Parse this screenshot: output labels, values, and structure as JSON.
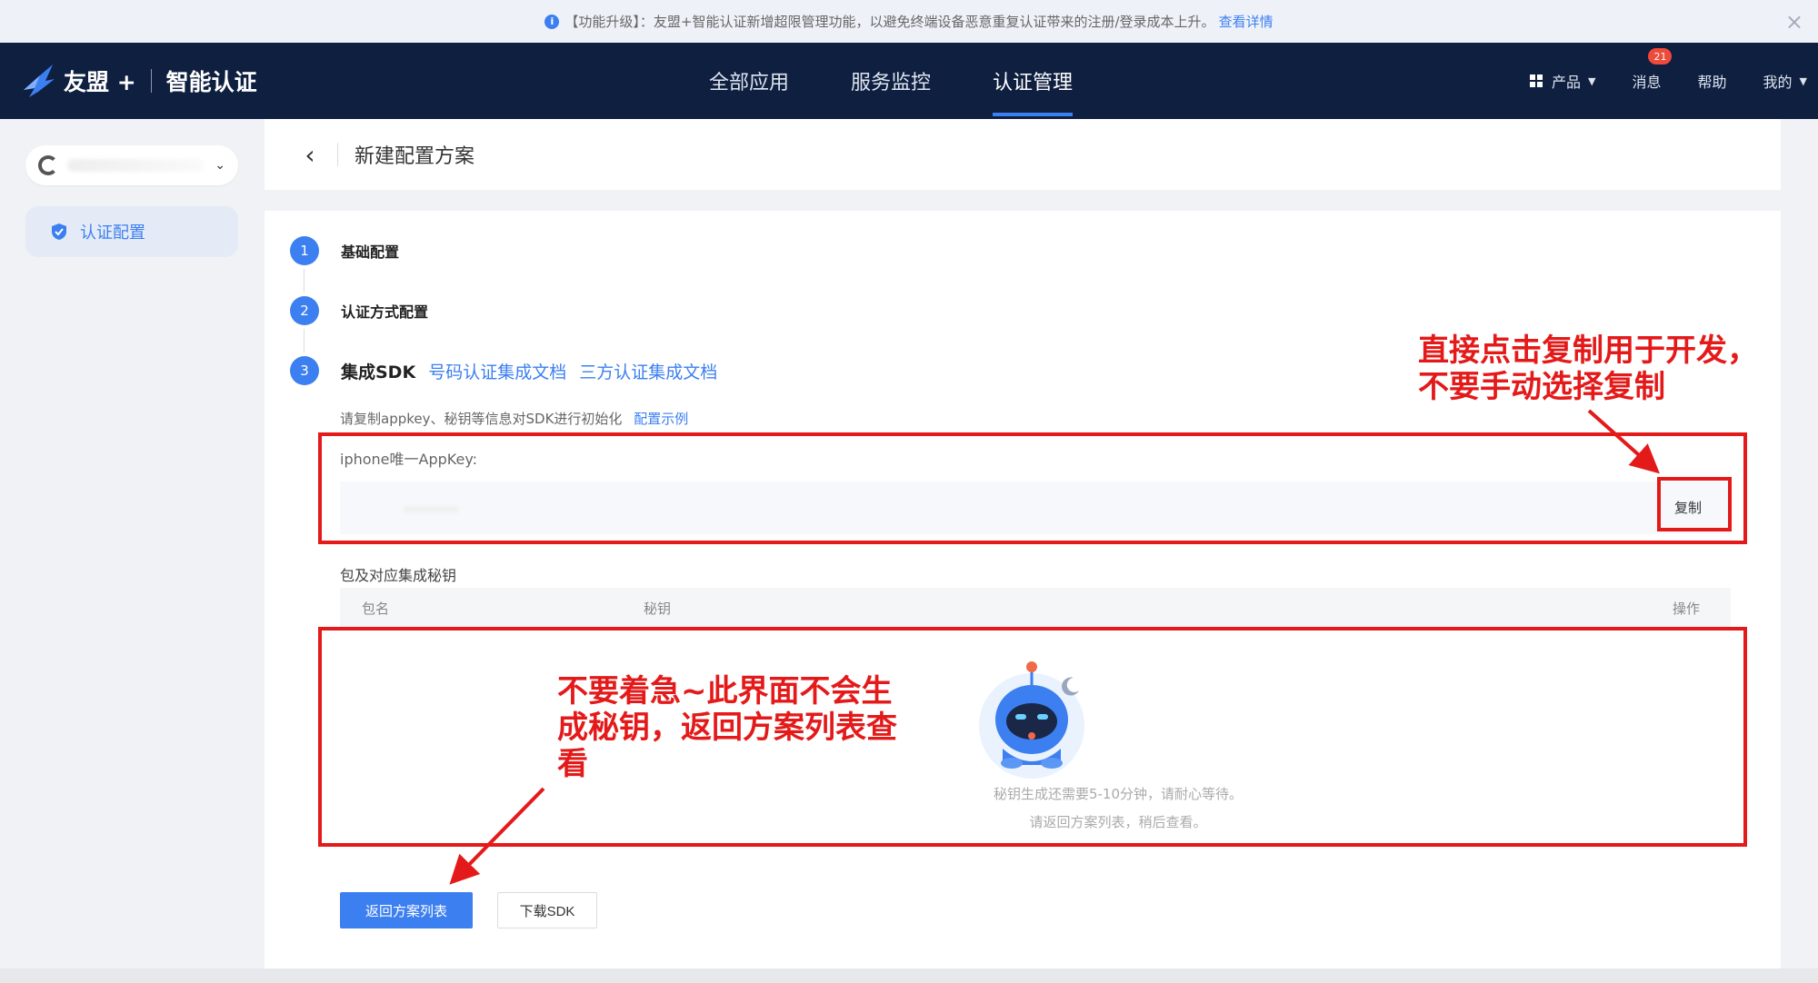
{
  "notice": {
    "text": "【功能升级】：友盟+智能认证新增超限管理功能，以避免终端设备恶意重复认证带来的注册/登录成本上升。",
    "link": "查看详情",
    "close": "×"
  },
  "topnav": {
    "brand": "友盟 +",
    "product": "智能认证",
    "items": [
      {
        "label": "全部应用"
      },
      {
        "label": "服务监控"
      },
      {
        "label": "认证管理"
      }
    ],
    "right": {
      "products": "产品",
      "messages": "消息",
      "messages_badge": "21",
      "help": "帮助",
      "mine": "我的"
    }
  },
  "sidebar": {
    "item": "认证配置"
  },
  "header": {
    "title": "新建配置方案"
  },
  "steps": [
    {
      "num": "1",
      "label": "基础配置"
    },
    {
      "num": "2",
      "label": "认证方式配置"
    },
    {
      "num": "3",
      "label": "集成SDK",
      "links": [
        "号码认证集成文档",
        "三方认证集成文档"
      ]
    }
  ],
  "sdk": {
    "hint": "请复制appkey、秘钥等信息对SDK进行初始化",
    "hint_link": "配置示例",
    "appkey_label": "iphone唯一AppKey:",
    "copy": "复制",
    "secret_label": "包及对应集成秘钥",
    "columns": [
      "包名",
      "秘钥",
      "操作"
    ],
    "empty_line1": "秘钥生成还需要5-10分钟，请耐心等待。",
    "empty_line2": "请返回方案列表，稍后查看。"
  },
  "buttons": {
    "back_list": "返回方案列表",
    "download": "下载SDK"
  },
  "annotations": {
    "copy_note": [
      "直接点击复制用于开发，",
      "不要手动选择复制"
    ],
    "wait_note": [
      "不要着急~此界面不会生",
      "成秘钥，返回方案列表查",
      "看"
    ]
  },
  "colors": {
    "accent": "#3c7ff0",
    "nav_bg": "#0f1f40",
    "annotation": "#e41a1a"
  }
}
